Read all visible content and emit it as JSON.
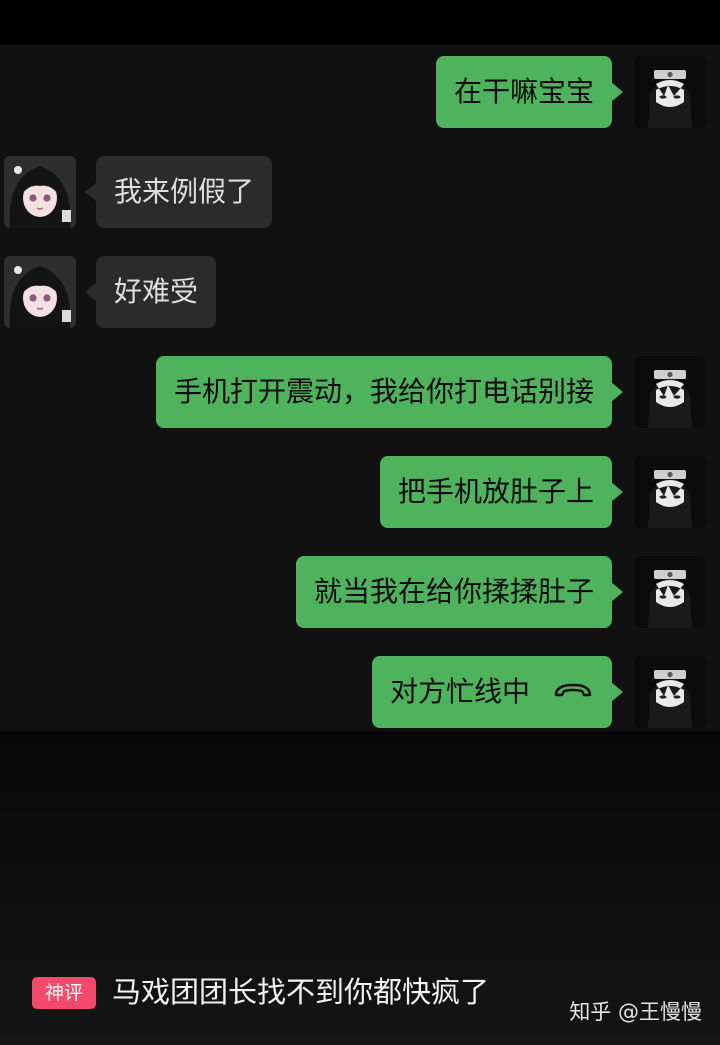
{
  "messages": [
    {
      "side": "right",
      "text": "在干嘛宝宝"
    },
    {
      "side": "left",
      "text": "我来例假了"
    },
    {
      "side": "left",
      "text": "好难受"
    },
    {
      "side": "right",
      "text": "手机打开震动，我给你打电话别接"
    },
    {
      "side": "right",
      "text": "把手机放肚子上"
    },
    {
      "side": "right",
      "text": "就当我在给你揉揉肚子"
    },
    {
      "side": "right",
      "text": "对方忙线中"
    }
  ],
  "comment": {
    "badge": "神评",
    "text": "马戏团团长找不到你都快疯了"
  },
  "watermark": "知乎 @王慢慢",
  "icons": {
    "call_status": "phone-hangup-icon",
    "self_avatar": "avatar-icon",
    "contact_avatar": "avatar-icon"
  },
  "colors": {
    "outgoing_bubble": "#4fb35d",
    "incoming_bubble": "#2b2b2b",
    "badge": "#f24a6a"
  }
}
